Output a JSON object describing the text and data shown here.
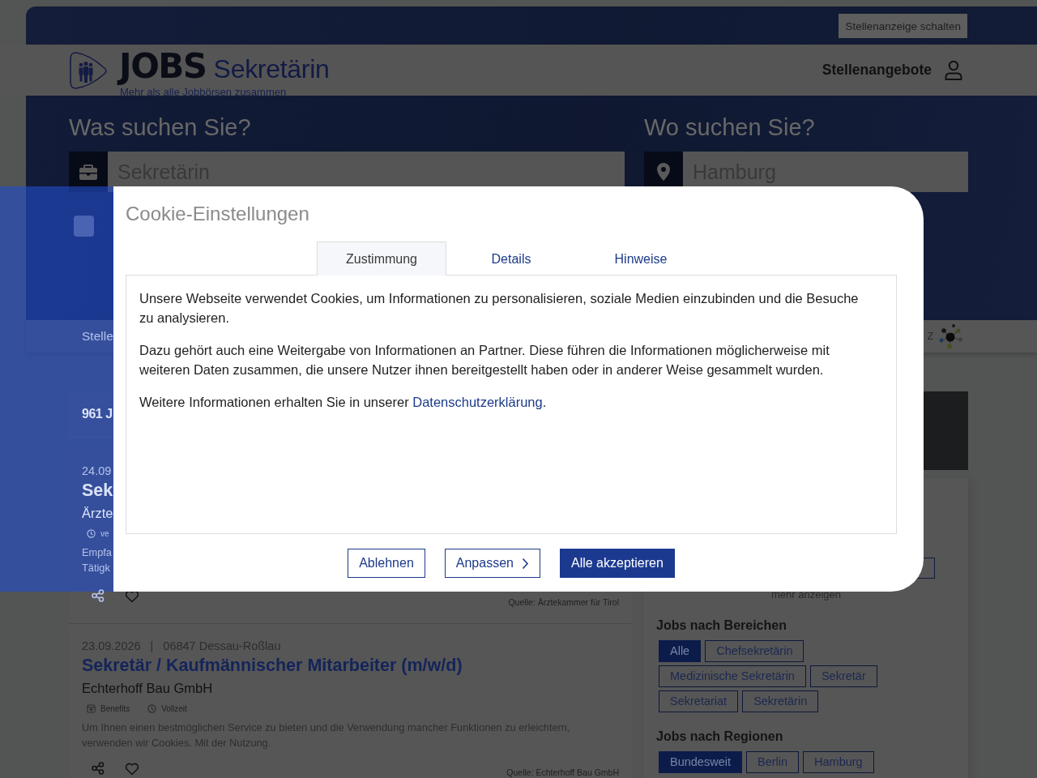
{
  "top_bar": {
    "post_job_button": "Stellenanzeige schalten"
  },
  "header": {
    "logo_word": "JOBS",
    "logo_title": "Sekretärin",
    "tagline": "Mehr als alle Jobbörsen zusammen",
    "nav_link": "Stellenangebote"
  },
  "search": {
    "fields": [
      {
        "kind": "what",
        "label": "Was suchen Sie?",
        "value": "Sekretärin"
      },
      {
        "kind": "where",
        "label": "Wo suchen Sie?",
        "value": "Hamburg"
      }
    ],
    "option": {
      "checked": false
    }
  },
  "subnav": {
    "item": "Stelle",
    "partner_logo": "Z"
  },
  "results": {
    "count": "961 J",
    "jobs": [
      {
        "date": "24.09",
        "title": "Sek",
        "company": "Ärzte",
        "tags": [
          {
            "kind": "time",
            "label": "ve"
          }
        ],
        "description_lines": [
          "Empfa",
          "Tätigk"
        ],
        "source": "Quelle: Ärztekammer für Tirol"
      },
      {
        "date": "23.09.2026",
        "separator": "|",
        "location": "06847 Dessau-Roßlau",
        "title": "Sekretär / Kaufmännischer Mitarbeiter (m/w/d)",
        "company": "Echterhoff Bau GmbH",
        "tags": [
          {
            "kind": "benefits",
            "label": "Benefits"
          },
          {
            "kind": "time",
            "label": "Vollzeit"
          }
        ],
        "description": "Um Ihnen einen bestmöglichen Service zu bieten und die Verwendung mancher Funktionen zu erleichtern, verwenden wir Cookies. Mit der Nutzung.",
        "source": "Quelle: Echterhoff Bau GmbH"
      }
    ]
  },
  "sidebar": {
    "more_link": "mehr anzeigen",
    "filters": [
      {
        "title": "Jobs nach Bereichen",
        "chips": [
          {
            "label": "Alle",
            "selected": true
          },
          {
            "label": "Chefsekretärin",
            "selected": false
          },
          {
            "label": "Medizinische Sekretärin",
            "selected": false
          },
          {
            "label": "Sekretär",
            "selected": false
          },
          {
            "label": "Sekretariat",
            "selected": false
          },
          {
            "label": "Sekretärin",
            "selected": false
          }
        ]
      },
      {
        "title": "Jobs nach Regionen",
        "chips": [
          {
            "label": "Bundesweit",
            "selected": true
          },
          {
            "label": "Berlin",
            "selected": false
          },
          {
            "label": "Hamburg",
            "selected": false
          }
        ]
      }
    ]
  },
  "cookie_dialog": {
    "title": "Cookie-Einstellungen",
    "tabs": [
      {
        "label": "Zustimmung",
        "selected": true
      },
      {
        "label": "Details",
        "selected": false
      },
      {
        "label": "Hinweise",
        "selected": false
      }
    ],
    "paragraphs": [
      {
        "text": "Unsere Webseite verwendet Cookies, um Informationen zu personalisieren, soziale Medien einzubinden und die Besuche zu analysieren."
      },
      {
        "text": "Dazu gehört auch eine Weitergabe von Informationen an Partner. Diese führen die Informationen möglicherweise mit weiteren Daten zusammen, die unsere Nutzer ihnen bereitgestellt haben oder in anderer Weise gesammelt wurden."
      },
      {
        "text": "Weitere Informationen erhalten Sie in unserer ",
        "link": "Datenschutzerklärung",
        "end": "."
      }
    ],
    "buttons": [
      {
        "label": "Ablehnen",
        "kind": "outline"
      },
      {
        "label": "Anpassen",
        "kind": "next"
      },
      {
        "label": "Alle akzeptieren",
        "kind": "primary"
      }
    ]
  }
}
